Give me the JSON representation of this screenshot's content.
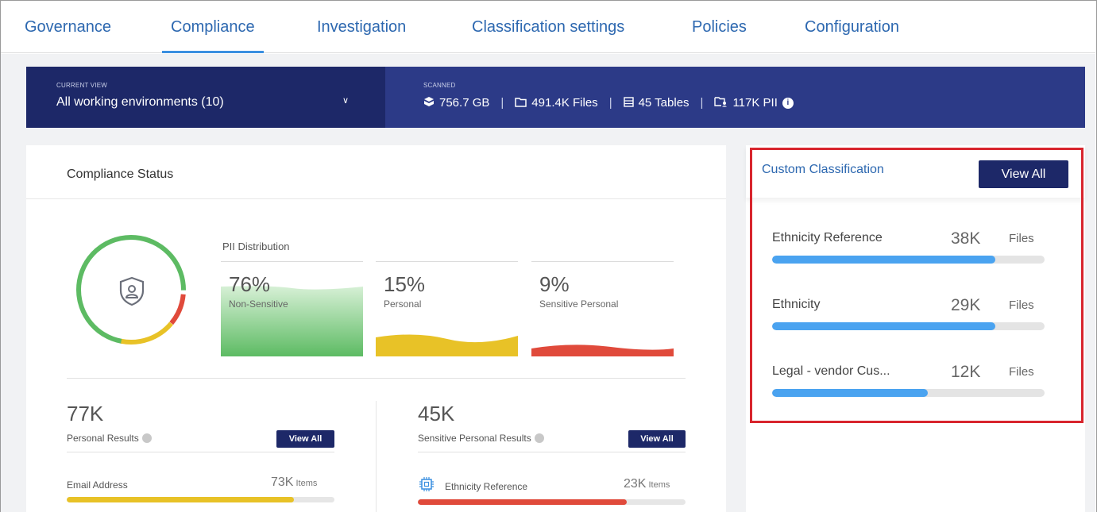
{
  "nav": {
    "tabs": [
      {
        "label": "Governance",
        "active": false
      },
      {
        "label": "Compliance",
        "active": true
      },
      {
        "label": "Investigation",
        "active": false
      },
      {
        "label": "Classification settings",
        "active": false
      },
      {
        "label": "Policies",
        "active": false
      },
      {
        "label": "Configuration",
        "active": false
      }
    ]
  },
  "banner": {
    "current_view_caption": "CURRENT VIEW",
    "current_view_value": "All working environments (10)",
    "scanned_caption": "SCANNED",
    "scanned_size": "756.7 GB",
    "files": "491.4K Files",
    "tables": "45 Tables",
    "pii": "117K PII"
  },
  "compliance_status": {
    "title": "Compliance Status",
    "pii_distribution_title": "PII Distribution",
    "pii": [
      {
        "pct": "76%",
        "label": "Non-Sensitive",
        "color": "#5dbb63"
      },
      {
        "pct": "15%",
        "label": "Personal",
        "color": "#e8c227"
      },
      {
        "pct": "9%",
        "label": "Sensitive Personal",
        "color": "#e04a3b"
      }
    ],
    "personal": {
      "count": "77K",
      "label": "Personal Results",
      "button": "View All",
      "item_label": "Email Address",
      "item_value": "73K",
      "item_unit": "Items",
      "item_fraction": 0.85
    },
    "sensitive": {
      "count": "45K",
      "label": "Sensitive Personal Results",
      "button": "View All",
      "item_label": "Ethnicity Reference",
      "item_value": "23K",
      "item_unit": "Items",
      "item_fraction": 0.78
    }
  },
  "custom_classification": {
    "title": "Custom Classification",
    "button": "View All",
    "items": [
      {
        "label": "Ethnicity Reference",
        "value": "38K",
        "unit": "Files",
        "fraction": 0.82
      },
      {
        "label": "Ethnicity",
        "value": "29K",
        "unit": "Files",
        "fraction": 0.82
      },
      {
        "label": "Legal - vendor Cus...",
        "value": "12K",
        "unit": "Files",
        "fraction": 0.57
      }
    ]
  },
  "colors": {
    "accent": "#2d68b0",
    "banner_dark": "#1d2868",
    "banner": "#2c3a87",
    "highlight": "#d8252d",
    "bar_blue": "#4aa3f0"
  }
}
